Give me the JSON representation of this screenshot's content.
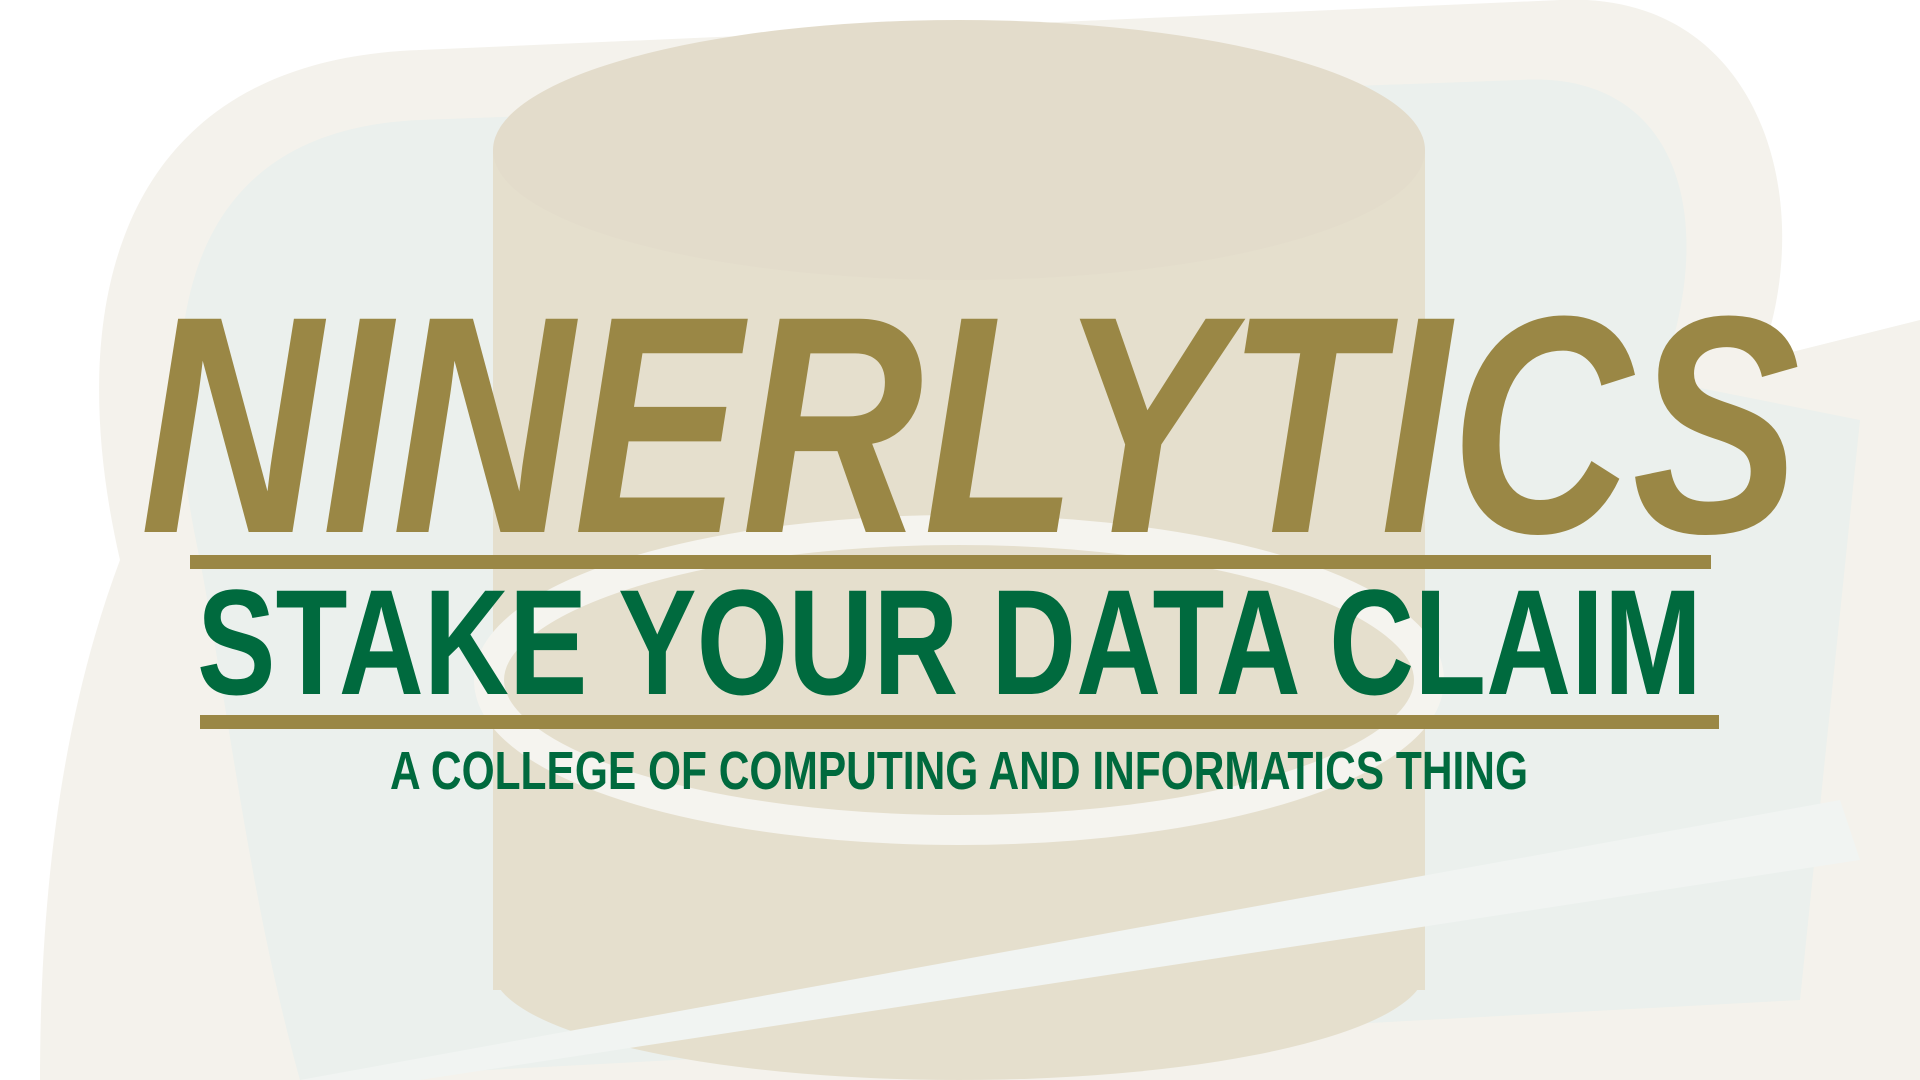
{
  "poster": {
    "title": "NINERLYTICS",
    "subtitle": "STAKE YOUR DATA CLAIM",
    "tagline": "A COLLEGE OF COMPUTING AND INFORMATICS THING"
  },
  "colors": {
    "gold": "#9a8745",
    "green": "#006a3e",
    "watermark_gold": "#e3dcc8",
    "watermark_green": "#e6ede9"
  }
}
